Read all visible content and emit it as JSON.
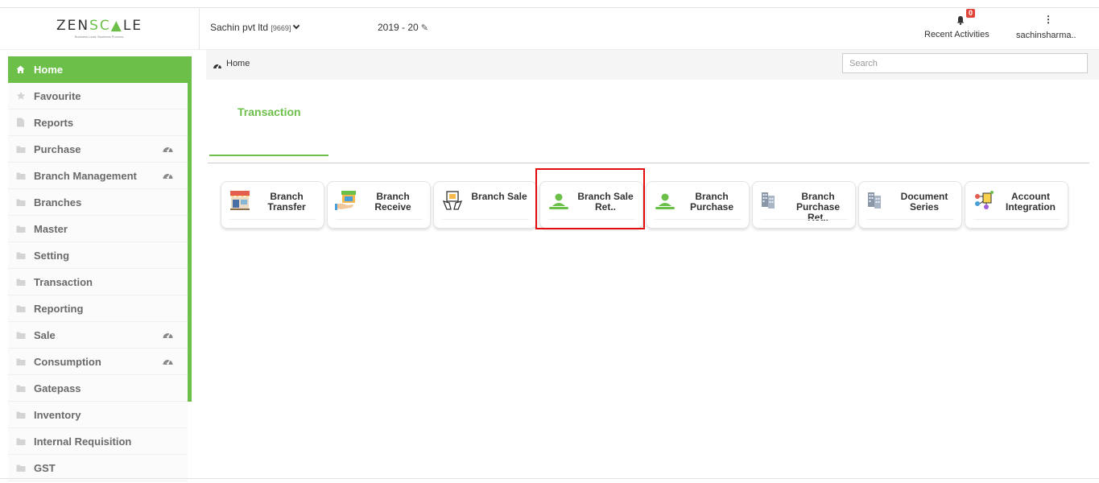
{
  "brand": {
    "name_a": "ZEN",
    "name_b": "SC",
    "name_c": "LE",
    "tagline": "Business Lead. Business Process.",
    "accent": "#6cc04a"
  },
  "header": {
    "company": "Sachin pvt ltd",
    "company_code": "[9669]",
    "year": "2019 - 20",
    "notifications_count": "0",
    "recent_label": "Recent Activities",
    "kebab": "⋮",
    "user": "sachinsharma.."
  },
  "sidebar": {
    "items": [
      {
        "label": "Home",
        "icon": "home-icon",
        "active": true
      },
      {
        "label": "Favourite",
        "icon": "star-icon"
      },
      {
        "label": "Reports",
        "icon": "file-icon"
      },
      {
        "label": "Purchase",
        "icon": "folder-icon",
        "dashboard": true
      },
      {
        "label": "Branch Management",
        "icon": "folder-icon",
        "dashboard": true
      },
      {
        "label": "Branches",
        "icon": "folder-icon"
      },
      {
        "label": "Master",
        "icon": "folder-icon"
      },
      {
        "label": "Setting",
        "icon": "folder-icon"
      },
      {
        "label": "Transaction",
        "icon": "folder-icon"
      },
      {
        "label": "Reporting",
        "icon": "folder-icon"
      },
      {
        "label": "Sale",
        "icon": "folder-icon",
        "dashboard": true
      },
      {
        "label": "Consumption",
        "icon": "folder-icon",
        "dashboard": true
      },
      {
        "label": "Gatepass",
        "icon": "folder-icon"
      },
      {
        "label": "Inventory",
        "icon": "folder-icon"
      },
      {
        "label": "Internal Requisition",
        "icon": "folder-icon"
      },
      {
        "label": "GST",
        "icon": "folder-icon"
      }
    ]
  },
  "breadcrumb": {
    "label": "Home"
  },
  "search": {
    "placeholder": "Search",
    "value": ""
  },
  "tab": {
    "label": "Transaction"
  },
  "tiles": [
    {
      "label": "Branch Transfer",
      "icon": "shop-icon"
    },
    {
      "label": "Branch Receive",
      "icon": "hand-shop-icon"
    },
    {
      "label": "Branch Sale",
      "icon": "sale-icon"
    },
    {
      "label": "Branch Sale Ret..",
      "icon": "person-icon",
      "highlighted": true
    },
    {
      "label": "Branch Purchase",
      "icon": "person-icon"
    },
    {
      "label": "Branch Purchase Ret..",
      "icon": "buildings-icon"
    },
    {
      "label": "Document Series",
      "icon": "buildings-icon"
    },
    {
      "label": "Account Integration",
      "icon": "integration-icon"
    }
  ]
}
